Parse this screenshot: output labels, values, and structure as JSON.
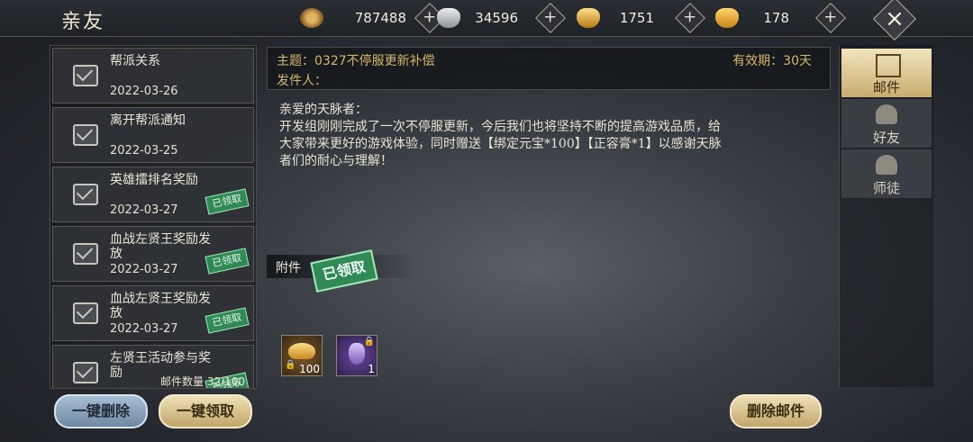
{
  "header": {
    "title": "亲友",
    "currencies": [
      {
        "icon": "copper-coin-icon",
        "value": "787488",
        "color": "#c7903f"
      },
      {
        "icon": "silver-ingot-icon",
        "value": "34596",
        "color": "#c9cbce"
      },
      {
        "icon": "bound-gold-ingot-icon",
        "value": "1751",
        "color": "#e7b33c"
      },
      {
        "icon": "gold-ingot-icon",
        "value": "178",
        "color": "#f1b530"
      }
    ],
    "plus": "+",
    "close": "×"
  },
  "mail_list": {
    "items": [
      {
        "title": "帮派关系",
        "date": "2022-03-26",
        "claimed": false
      },
      {
        "title": "离开帮派通知",
        "date": "2022-03-25",
        "claimed": false
      },
      {
        "title": "英雄擂排名奖励",
        "date": "2022-03-27",
        "claimed": true
      },
      {
        "title": "血战左贤王奖励发放",
        "date": "2022-03-27",
        "claimed": true
      },
      {
        "title": "血战左贤王奖励发放",
        "date": "2022-03-27",
        "claimed": true
      },
      {
        "title": "左贤王活动参与奖励",
        "date": "",
        "claimed": true
      }
    ],
    "claimed_stamp": "已领取",
    "count_label": "邮件数量 32/100",
    "delete_all": "一键删除",
    "claim_all": "一键领取"
  },
  "mail": {
    "subject": "主题：0327不停服更新补偿",
    "validity": "有效期：30天",
    "sender": "发件人：",
    "body": "亲爱的天脉者：\n开发组刚刚完成了一次不停服更新，今后我们也将坚持不断的提高游戏品质，给大家带来更好的游戏体验，同时赠送【绑定元宝*100】【正容膏*1】以感谢天脉者们的耐心与理解！",
    "attachment_label": "附件",
    "claimed_stamp": "已领取",
    "attachments": [
      {
        "icon": "bound-gold-ingot-icon",
        "qty": "100"
      },
      {
        "icon": "potion-bottle-icon",
        "qty": "1"
      }
    ],
    "delete_button": "删除邮件"
  },
  "tabs": [
    {
      "label": "邮件",
      "icon": "scroll-icon",
      "active": true
    },
    {
      "label": "好友",
      "icon": "friend-figure-icon",
      "active": false
    },
    {
      "label": "师徒",
      "icon": "master-apprentice-icon",
      "active": false
    }
  ]
}
